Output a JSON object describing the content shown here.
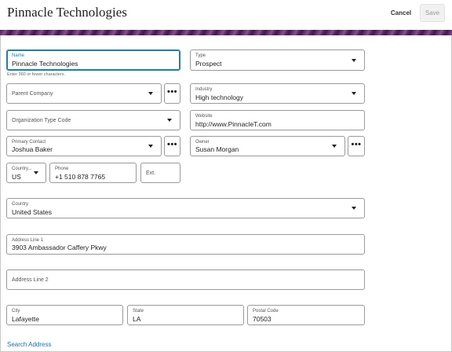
{
  "header": {
    "title": "Pinnacle Technologies",
    "cancel_label": "Cancel",
    "save_label": "Save"
  },
  "form": {
    "name": {
      "label": "Name",
      "value": "Pinnacle Technologies",
      "hint": "Enter 360 or fewer characters."
    },
    "type": {
      "label": "Type",
      "value": "Prospect"
    },
    "parent_company": {
      "label": "Parent Company",
      "more": "•••"
    },
    "industry": {
      "label": "Industry",
      "value": "High technology"
    },
    "organization_type_code": {
      "label": "Organization Type Code"
    },
    "website": {
      "label": "Website",
      "value": "http://www.PinnacleT.com"
    },
    "primary_contact": {
      "label": "Primary Contact",
      "value": "Joshua Baker",
      "more": "•••"
    },
    "owner": {
      "label": "Owner",
      "value": "Susan Morgan",
      "more": "•••"
    },
    "phone_country": {
      "label": "Country...",
      "value": "US"
    },
    "phone": {
      "label": "Phone",
      "value": "+1 510 878 7765"
    },
    "ext": {
      "label": "Ext."
    },
    "country": {
      "label": "Country",
      "value": "United States"
    },
    "address_line_1": {
      "label": "Address Line 1",
      "value": "3903 Ambassador Caffery Pkwy"
    },
    "address_line_2": {
      "label": "Address Line 2"
    },
    "city": {
      "label": "City",
      "value": "Lafayette"
    },
    "state": {
      "label": "State",
      "value": "LA"
    },
    "postal_code": {
      "label": "Postal Code",
      "value": "70503"
    },
    "search_address_label": "Search Address"
  },
  "colors": {
    "focus": "#227e9e",
    "link": "#1e6fa8",
    "banner": "#5a2a63"
  }
}
